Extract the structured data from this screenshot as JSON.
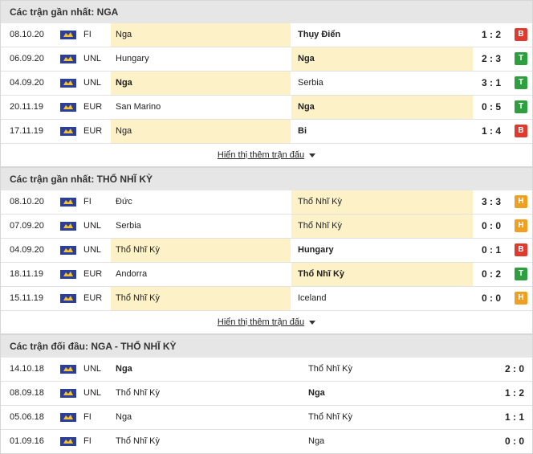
{
  "colors": {
    "win": "#2e9f3f",
    "draw": "#f0a020",
    "loss": "#e03a2f",
    "highlight": "#fcf1c7"
  },
  "sections": [
    {
      "title": "Các trận gần nhất: NGA",
      "more": "Hiển thị thêm trận đấu",
      "rows": [
        {
          "date": "08.10.20",
          "comp": "FI",
          "home": "Nga",
          "away": "Thụy Điển",
          "score": "1 : 2",
          "result": "B"
        },
        {
          "date": "06.09.20",
          "comp": "UNL",
          "home": "Hungary",
          "away": "Nga",
          "score": "2 : 3",
          "result": "T"
        },
        {
          "date": "04.09.20",
          "comp": "UNL",
          "home": "Nga",
          "away": "Serbia",
          "score": "3 : 1",
          "result": "T"
        },
        {
          "date": "20.11.19",
          "comp": "EUR",
          "home": "San Marino",
          "away": "Nga",
          "score": "0 : 5",
          "result": "T"
        },
        {
          "date": "17.11.19",
          "comp": "EUR",
          "home": "Nga",
          "away": "Bi",
          "score": "1 : 4",
          "result": "B"
        }
      ]
    },
    {
      "title": "Các trận gần nhất: THỔ NHĨ KỲ",
      "more": "Hiển thị thêm trận đấu",
      "rows": [
        {
          "date": "08.10.20",
          "comp": "FI",
          "home": "Đức",
          "away": "Thổ Nhĩ Kỳ",
          "score": "3 : 3",
          "result": "H"
        },
        {
          "date": "07.09.20",
          "comp": "UNL",
          "home": "Serbia",
          "away": "Thổ Nhĩ Kỳ",
          "score": "0 : 0",
          "result": "H"
        },
        {
          "date": "04.09.20",
          "comp": "UNL",
          "home": "Thổ Nhĩ Kỳ",
          "away": "Hungary",
          "score": "0 : 1",
          "result": "B"
        },
        {
          "date": "18.11.19",
          "comp": "EUR",
          "home": "Andorra",
          "away": "Thổ Nhĩ Kỳ",
          "score": "0 : 2",
          "result": "T"
        },
        {
          "date": "15.11.19",
          "comp": "EUR",
          "home": "Thổ Nhĩ Kỳ",
          "away": "Iceland",
          "score": "0 : 0",
          "result": "H"
        }
      ]
    },
    {
      "title": "Các trận đối đầu: NGA - THỔ NHĨ KỲ",
      "rows": [
        {
          "date": "14.10.18",
          "comp": "UNL",
          "home": "Nga",
          "away": "Thổ Nhĩ Kỳ",
          "score": "2 : 0"
        },
        {
          "date": "08.09.18",
          "comp": "UNL",
          "home": "Thổ Nhĩ Kỳ",
          "away": "Nga",
          "score": "1 : 2"
        },
        {
          "date": "05.06.18",
          "comp": "FI",
          "home": "Nga",
          "away": "Thổ Nhĩ Kỳ",
          "score": "1 : 1"
        },
        {
          "date": "01.09.16",
          "comp": "FI",
          "home": "Thổ Nhĩ Kỳ",
          "away": "Nga",
          "score": "0 : 0"
        }
      ]
    }
  ]
}
